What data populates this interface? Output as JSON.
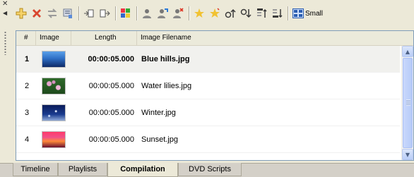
{
  "toolbar": {
    "buttons": [
      {
        "icon": "add-icon"
      },
      {
        "icon": "delete-icon"
      },
      {
        "icon": "swap-icon"
      },
      {
        "icon": "properties-icon"
      },
      {
        "icon": "import-icon"
      },
      {
        "icon": "export-icon"
      },
      {
        "icon": "effects-icon"
      },
      {
        "icon": "user-icon"
      },
      {
        "icon": "user-edit-icon"
      },
      {
        "icon": "user-remove-icon"
      },
      {
        "icon": "transition-icon"
      },
      {
        "icon": "transition-all-icon"
      },
      {
        "icon": "move-up-icon"
      },
      {
        "icon": "move-down-icon"
      },
      {
        "icon": "move-top-icon"
      },
      {
        "icon": "move-bottom-icon"
      }
    ],
    "view_toggle_label": "Small"
  },
  "table": {
    "columns": [
      "#",
      "Image",
      "Length",
      "Image Filename"
    ],
    "rows": [
      {
        "num": "1",
        "length": "00:00:05.000",
        "filename": "Blue hills.jpg",
        "thumb": "blue-hills"
      },
      {
        "num": "2",
        "length": "00:00:05.000",
        "filename": "Water lilies.jpg",
        "thumb": "water-lilies"
      },
      {
        "num": "3",
        "length": "00:00:05.000",
        "filename": "Winter.jpg",
        "thumb": "winter"
      },
      {
        "num": "4",
        "length": "00:00:05.000",
        "filename": "Sunset.jpg",
        "thumb": "sunset"
      }
    ],
    "selected_row": 0
  },
  "tabs": [
    "Timeline",
    "Playlists",
    "Compilation",
    "DVD Scripts"
  ],
  "active_tab": "Compilation",
  "colors": {
    "accent": "#7f9db9",
    "panel_bg": "#ece9d8"
  }
}
